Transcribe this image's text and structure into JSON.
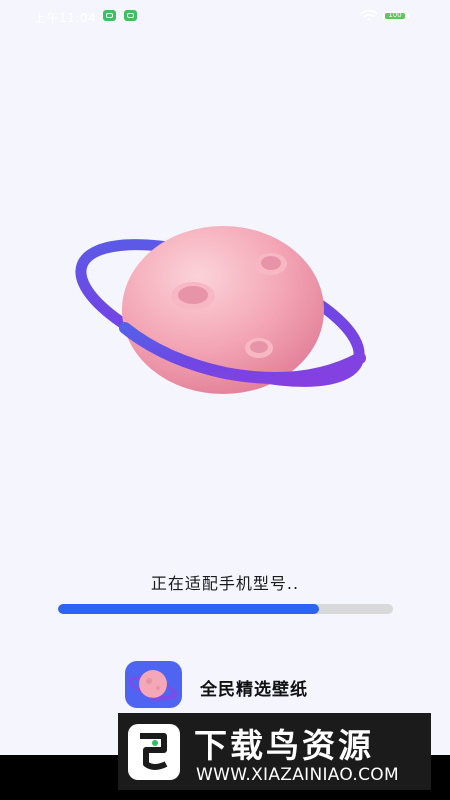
{
  "status_bar": {
    "time": "上午11:04",
    "battery_level": "100"
  },
  "splash": {
    "loading_text": "正在适配手机型号..",
    "progress": 0.78
  },
  "app": {
    "name": "全民精选壁纸"
  },
  "watermark": {
    "title": "下载鸟资源",
    "url": "WWW.XIAZAINIAO.COM"
  },
  "colors": {
    "background": "#f4f5fd",
    "progress_fill": "#2f62f2",
    "progress_track": "#d9d9db",
    "status_green": "#3fbf5f"
  }
}
